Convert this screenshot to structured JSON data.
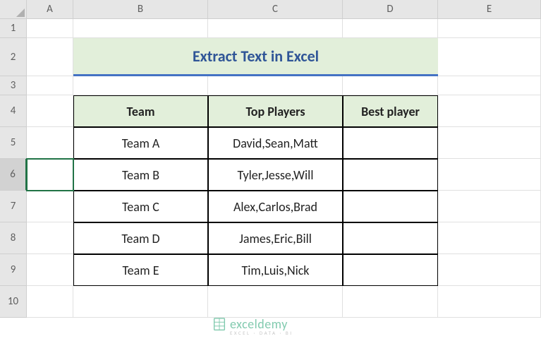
{
  "columns": [
    "A",
    "B",
    "C",
    "D",
    "E"
  ],
  "rows": [
    "1",
    "2",
    "3",
    "4",
    "5",
    "6",
    "7",
    "8",
    "9",
    "10"
  ],
  "title": "Extract Text in Excel",
  "headers": {
    "team": "Team",
    "top": "Top Players",
    "best": "Best player"
  },
  "data": [
    {
      "team": "Team A",
      "top": "David,Sean,Matt",
      "best": ""
    },
    {
      "team": "Team B",
      "top": "Tyler,Jesse,Will",
      "best": ""
    },
    {
      "team": "Team C",
      "top": "Alex,Carlos,Brad",
      "best": ""
    },
    {
      "team": "Team D",
      "top": "James,Eric,Bill",
      "best": ""
    },
    {
      "team": "Team E",
      "top": "Tim,Luis,Nick",
      "best": ""
    }
  ],
  "watermark": {
    "name": "exceldemy",
    "tag": "EXCEL · DATA · BI"
  },
  "active_row": "6",
  "chart_data": {
    "type": "table",
    "title": "Extract Text in Excel",
    "columns": [
      "Team",
      "Top Players",
      "Best player"
    ],
    "rows": [
      [
        "Team A",
        "David,Sean,Matt",
        ""
      ],
      [
        "Team B",
        "Tyler,Jesse,Will",
        ""
      ],
      [
        "Team C",
        "Alex,Carlos,Brad",
        ""
      ],
      [
        "Team D",
        "James,Eric,Bill",
        ""
      ],
      [
        "Team E",
        "Tim,Luis,Nick",
        ""
      ]
    ]
  }
}
